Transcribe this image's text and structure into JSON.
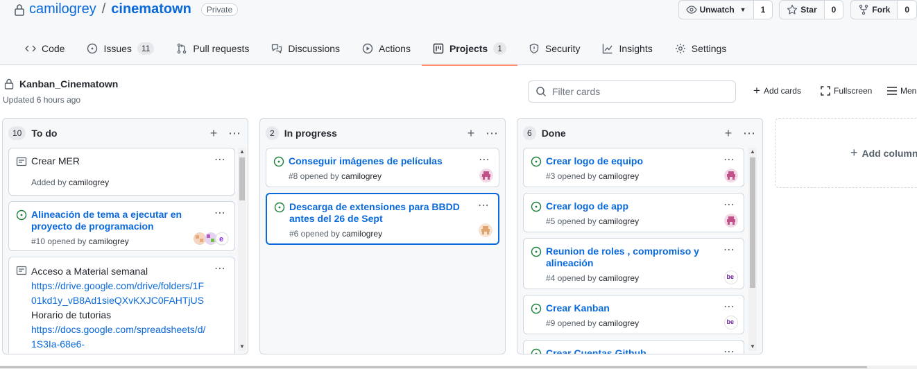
{
  "repo": {
    "owner": "camilogrey",
    "separator": "/",
    "name": "cinematown",
    "visibility": "Private",
    "watch_label": "Unwatch",
    "watch_count": "1",
    "star_label": "Star",
    "star_count": "0",
    "fork_label": "Fork",
    "fork_count": "0"
  },
  "nav": [
    {
      "label": "Code",
      "icon": "code-icon"
    },
    {
      "label": "Issues",
      "icon": "issue-opened-icon",
      "count": "11"
    },
    {
      "label": "Pull requests",
      "icon": "git-pull-request-icon"
    },
    {
      "label": "Discussions",
      "icon": "comment-discussion-icon"
    },
    {
      "label": "Actions",
      "icon": "play-icon"
    },
    {
      "label": "Projects",
      "icon": "project-icon",
      "count": "1",
      "active": true
    },
    {
      "label": "Security",
      "icon": "shield-icon"
    },
    {
      "label": "Insights",
      "icon": "graph-icon"
    },
    {
      "label": "Settings",
      "icon": "gear-icon"
    }
  ],
  "project": {
    "title": "Kanban_Cinematown",
    "updated": "Updated 6 hours ago",
    "filter_placeholder": "Filter cards",
    "add_cards": "Add cards",
    "fullscreen": "Fullscreen",
    "menu": "Menu",
    "add_column": "Add column"
  },
  "columns": [
    {
      "count": "10",
      "name": "To do",
      "cards": [
        {
          "type": "note",
          "title": "Crear MER",
          "meta_prefix": "Added by",
          "meta_user": "camilogrey"
        },
        {
          "type": "issue",
          "title": "Alineación de tema a ejecutar en proyecto de programacion",
          "meta_prefix": "#10 opened by",
          "meta_user": "camilogrey"
        },
        {
          "type": "note",
          "title": "Acceso a Material semanal",
          "link1": "https://drive.google.com/drive/folders/1F01kd1y_vB8Ad1sieQXvKXJC0FAHTjUS",
          "text2": "Horario de tutorias",
          "link2": "https://docs.google.com/spreadsheets/d/1S3Ia-68e6-"
        }
      ]
    },
    {
      "count": "2",
      "name": "In progress",
      "cards": [
        {
          "type": "issue",
          "title": "Conseguir imágenes de películas",
          "meta_prefix": "#8 opened by",
          "meta_user": "camilogrey"
        },
        {
          "type": "issue",
          "title": "Descarga de extensiones para BBDD antes del 26 de Sept",
          "meta_prefix": "#6 opened by",
          "meta_user": "camilogrey"
        }
      ]
    },
    {
      "count": "6",
      "name": "Done",
      "cards": [
        {
          "type": "issue",
          "title": "Crear logo de equipo",
          "meta_prefix": "#3 opened by",
          "meta_user": "camilogrey"
        },
        {
          "type": "issue",
          "title": "Crear logo de app",
          "meta_prefix": "#5 opened by",
          "meta_user": "camilogrey"
        },
        {
          "type": "issue",
          "title": "Reunion de roles , compromiso y alineación",
          "meta_prefix": "#4 opened by",
          "meta_user": "camilogrey"
        },
        {
          "type": "issue",
          "title": "Crear Kanban",
          "meta_prefix": "#9 opened by",
          "meta_user": "camilogrey"
        },
        {
          "type": "issue",
          "title": "Crear Cuentas Github"
        }
      ]
    }
  ],
  "colors": {
    "link": "#0969da",
    "open_issue": "#1a7f37",
    "active_tab_underline": "#fd8c73"
  }
}
